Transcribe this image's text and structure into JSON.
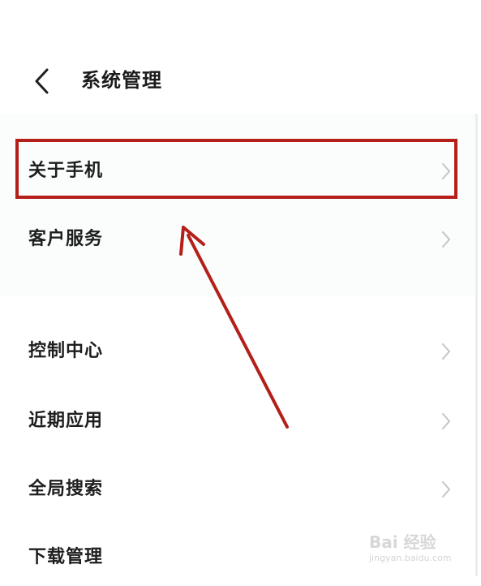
{
  "header": {
    "title": "系统管理",
    "back_icon": "chevron-left-icon"
  },
  "menu": {
    "group1": [
      {
        "label": "关于手机",
        "icon": "chevron-right-icon"
      },
      {
        "label": "客户服务",
        "icon": "chevron-right-icon"
      }
    ],
    "group2": [
      {
        "label": "控制中心",
        "icon": "chevron-right-icon"
      },
      {
        "label": "近期应用",
        "icon": "chevron-right-icon"
      },
      {
        "label": "全局搜索",
        "icon": "chevron-right-icon"
      },
      {
        "label": "下载管理",
        "icon": "chevron-right-icon"
      }
    ]
  },
  "annotation": {
    "highlight_color": "#b41f1a",
    "highlighted_item": "关于手机"
  },
  "watermark": {
    "brand": "Bai 经验",
    "url": "jingyan.baidu.com"
  }
}
